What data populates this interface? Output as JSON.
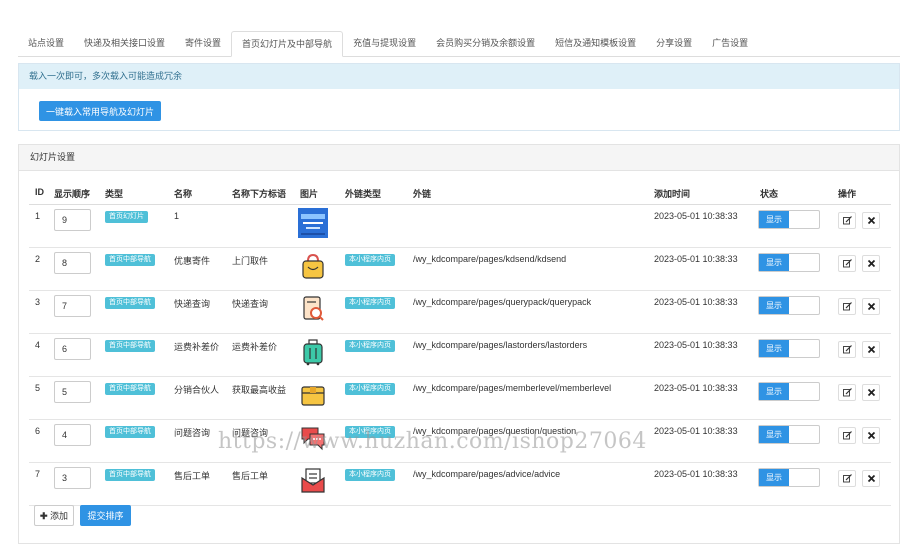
{
  "tabs": [
    {
      "label": "站点设置",
      "active": false
    },
    {
      "label": "快递及相关接口设置",
      "active": false
    },
    {
      "label": "寄件设置",
      "active": false
    },
    {
      "label": "首页幻灯片及中部导航",
      "active": true
    },
    {
      "label": "充值与提现设置",
      "active": false
    },
    {
      "label": "会员购买分销及余额设置",
      "active": false
    },
    {
      "label": "短信及通知模板设置",
      "active": false
    },
    {
      "label": "分享设置",
      "active": false
    },
    {
      "label": "广告设置",
      "active": false
    }
  ],
  "notice": {
    "text": "载入一次即可，多次载入可能造成冗余",
    "button_label": "一键载入常用导航及幻灯片"
  },
  "panel": {
    "title": "幻灯片设置"
  },
  "table": {
    "headers": {
      "id": "ID",
      "order": "显示顺序",
      "type": "类型",
      "name": "名称",
      "subtitle": "名称下方标语",
      "image": "图片",
      "link_type": "外链类型",
      "link": "外链",
      "added": "添加时间",
      "status": "状态",
      "actions": "操作"
    },
    "rows": [
      {
        "id": "1",
        "order": "9",
        "type": "首页幻灯片",
        "name": "1",
        "subtitle": "",
        "image_icon": "banner-thumbnail-icon",
        "link_type": "",
        "link": "",
        "added": "2023-05-01 10:38:33",
        "status": "显示"
      },
      {
        "id": "2",
        "order": "8",
        "type": "首页中部导航",
        "name": "优惠寄件",
        "subtitle": "上门取件",
        "image_icon": "shopping-bag-icon",
        "link_type": "本小程序内页",
        "link": "/wy_kdcompare/pages/kdsend/kdsend",
        "added": "2023-05-01 10:38:33",
        "status": "显示"
      },
      {
        "id": "3",
        "order": "7",
        "type": "首页中部导航",
        "name": "快递查询",
        "subtitle": "快递查询",
        "image_icon": "search-document-icon",
        "link_type": "本小程序内页",
        "link": "/wy_kdcompare/pages/querypack/querypack",
        "added": "2023-05-01 10:38:33",
        "status": "显示"
      },
      {
        "id": "4",
        "order": "6",
        "type": "首页中部导航",
        "name": "运费补差价",
        "subtitle": "运费补差价",
        "image_icon": "luggage-icon",
        "link_type": "本小程序内页",
        "link": "/wy_kdcompare/pages/lastorders/lastorders",
        "added": "2023-05-01 10:38:33",
        "status": "显示"
      },
      {
        "id": "5",
        "order": "5",
        "type": "首页中部导航",
        "name": "分销合伙人",
        "subtitle": "获取最高收益",
        "image_icon": "parcel-box-icon",
        "link_type": "本小程序内页",
        "link": "/wy_kdcompare/pages/memberlevel/memberlevel",
        "added": "2023-05-01 10:38:33",
        "status": "显示"
      },
      {
        "id": "6",
        "order": "4",
        "type": "首页中部导航",
        "name": "问题咨询",
        "subtitle": "问题咨询",
        "image_icon": "chat-bubbles-icon",
        "link_type": "本小程序内页",
        "link": "/wy_kdcompare/pages/question/question",
        "added": "2023-05-01 10:38:33",
        "status": "显示"
      },
      {
        "id": "7",
        "order": "3",
        "type": "首页中部导航",
        "name": "售后工单",
        "subtitle": "售后工单",
        "image_icon": "envelope-icon",
        "link_type": "本小程序内页",
        "link": "/wy_kdcompare/pages/advice/advice",
        "added": "2023-05-01 10:38:33",
        "status": "显示"
      }
    ]
  },
  "footer": {
    "add_label": "添加",
    "submit_label": "提交排序"
  },
  "watermark": "https://www.huzhan.com/ishop27064",
  "colors": {
    "primary": "#2f93e4",
    "badge": "#4fc0d8",
    "alert_bg": "#dff0f8",
    "alert_text": "#31708f"
  }
}
